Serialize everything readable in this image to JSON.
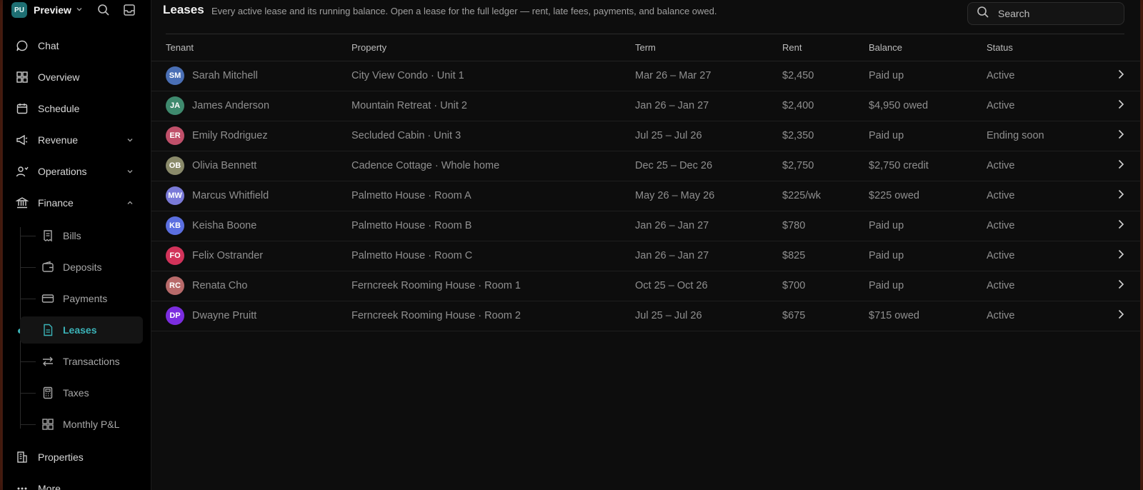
{
  "workspace": {
    "initials": "PU",
    "name": "Preview"
  },
  "nav": {
    "chat": "Chat",
    "overview": "Overview",
    "schedule": "Schedule",
    "revenue": "Revenue",
    "operations": "Operations",
    "finance": "Finance",
    "finance_items": [
      "Bills",
      "Deposits",
      "Payments",
      "Leases",
      "Transactions",
      "Taxes",
      "Monthly P&L"
    ],
    "properties": "Properties",
    "more": "More"
  },
  "page": {
    "title": "Leases",
    "subtitle": "Every active lease and its running balance. Open a lease for the full ledger — rent, late fees, payments, and balance owed."
  },
  "search": {
    "placeholder": "Search"
  },
  "table": {
    "columns": [
      "Tenant",
      "Property",
      "Term",
      "Rent",
      "Balance",
      "Status"
    ],
    "rows": [
      {
        "initials": "SM",
        "tenant": "Sarah Mitchell",
        "property": "City View Condo · Unit 1",
        "term": "Mar 26 – Mar 27",
        "rent": "$2,450",
        "balance": "Paid up",
        "status": "Active",
        "color": "#4a6fb5"
      },
      {
        "initials": "JA",
        "tenant": "James Anderson",
        "property": "Mountain Retreat · Unit 2",
        "term": "Jan 26 – Jan 27",
        "rent": "$2,400",
        "balance": "$4,950 owed",
        "status": "Active",
        "color": "#3f8a6e"
      },
      {
        "initials": "ER",
        "tenant": "Emily Rodriguez",
        "property": "Secluded Cabin · Unit 3",
        "term": "Jul 25 – Jul 26",
        "rent": "$2,350",
        "balance": "Paid up",
        "status": "Ending soon",
        "color": "#c0506a"
      },
      {
        "initials": "OB",
        "tenant": "Olivia Bennett",
        "property": "Cadence Cottage · Whole home",
        "term": "Dec 25 – Dec 26",
        "rent": "$2,750",
        "balance": "$2,750 credit",
        "status": "Active",
        "color": "#8a8a6a"
      },
      {
        "initials": "MW",
        "tenant": "Marcus Whitfield",
        "property": "Palmetto House · Room A",
        "term": "May 26 – May 26",
        "rent": "$225/wk",
        "balance": "$225 owed",
        "status": "Active",
        "color": "#7a7ad8"
      },
      {
        "initials": "KB",
        "tenant": "Keisha Boone",
        "property": "Palmetto House · Room B",
        "term": "Jan 26 – Jan 27",
        "rent": "$780",
        "balance": "Paid up",
        "status": "Active",
        "color": "#5b6fe0"
      },
      {
        "initials": "FO",
        "tenant": "Felix Ostrander",
        "property": "Palmetto House · Room C",
        "term": "Jan 26 – Jan 27",
        "rent": "$825",
        "balance": "Paid up",
        "status": "Active",
        "color": "#d2335a"
      },
      {
        "initials": "RC",
        "tenant": "Renata Cho",
        "property": "Ferncreek Rooming House · Room 1",
        "term": "Oct 25 – Oct 26",
        "rent": "$700",
        "balance": "Paid up",
        "status": "Active",
        "color": "#b86a6a"
      },
      {
        "initials": "DP",
        "tenant": "Dwayne Pruitt",
        "property": "Ferncreek Rooming House · Room 2",
        "term": "Jul 25 – Jul 26",
        "rent": "$675",
        "balance": "$715 owed",
        "status": "Active",
        "color": "#7b2de0"
      }
    ]
  }
}
